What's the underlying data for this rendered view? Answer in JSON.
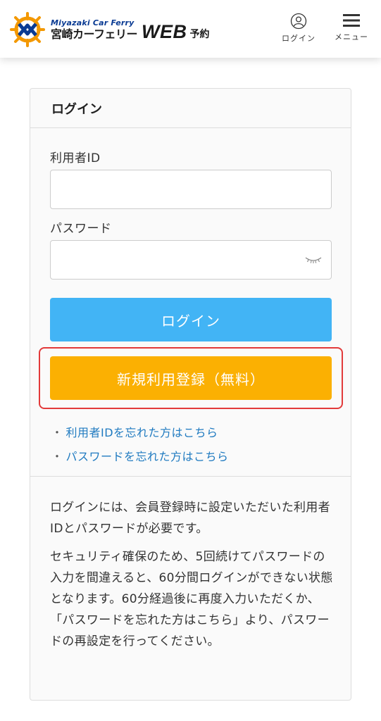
{
  "header": {
    "logo_en": "Miyazaki Car Ferry",
    "logo_jp": "宮崎カーフェリー",
    "logo_web": "WEB",
    "logo_yoyaku": "予約",
    "login_label": "ログイン",
    "menu_label": "メニュー"
  },
  "card": {
    "title": "ログイン",
    "user_id_label": "利用者ID",
    "user_id_value": "",
    "password_label": "パスワード",
    "password_value": "",
    "login_button": "ログイン",
    "register_button": "新規利用登録（無料）",
    "forgot_id_link": "利用者IDを忘れた方はこちら",
    "forgot_password_link": "パスワードを忘れた方はこちら",
    "bullet": "・",
    "note1": "ログインには、会員登録時に設定いただいた利用者IDとパスワードが必要です。",
    "note2": "セキュリティ確保のため、5回続けてパスワードの入力を間違えると、60分間ログインができない状態となります。60分経過後に再度入力いただくか、「パスワードを忘れた方はこちら」より、パスワードの再設定を行ってください。"
  },
  "colors": {
    "login_button": "#42b4f5",
    "register_button": "#fbb002",
    "highlight_border": "#e23a3a",
    "link": "#1f7ac0",
    "logo_blue": "#0a3b93",
    "logo_orange": "#f39800"
  }
}
